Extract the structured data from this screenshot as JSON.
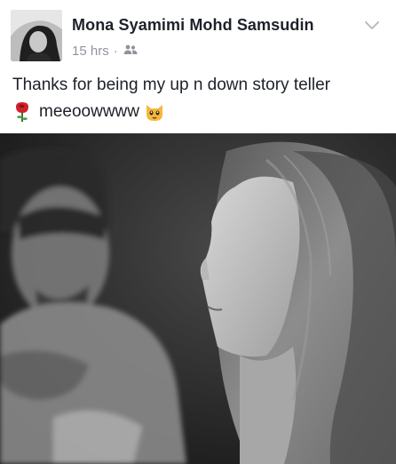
{
  "post": {
    "author": "Mona Syamimi Mohd Samsudin",
    "timestamp": "15 hrs",
    "separator": "·",
    "audience_icon": "friends-icon",
    "menu_icon": "chevron-down-icon",
    "message_line1": "Thanks for being my up n down story teller",
    "message_line2": "meeoowwww",
    "emojis": [
      "rose-emoji-icon",
      "cat-face-emoji-icon"
    ]
  },
  "photo": {
    "description_icon": "photo",
    "tone": "black-and-white"
  },
  "colors": {
    "text": "#1d2129",
    "meta": "#90949c",
    "rose": "#d0222b",
    "cat": "#f5b83d"
  }
}
